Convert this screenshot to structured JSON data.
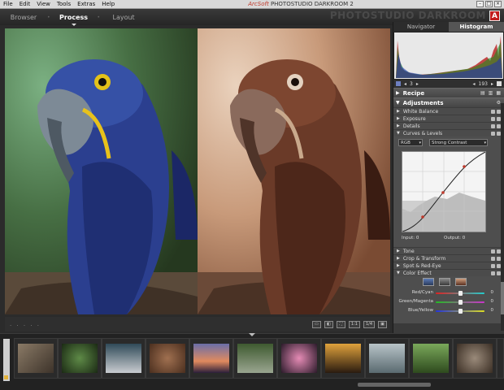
{
  "menubar": {
    "items": [
      "File",
      "Edit",
      "View",
      "Tools",
      "Extras",
      "Help"
    ],
    "brand_prefix": "ArcSoft",
    "app_title": "PHOTOSTUDIO DARKROOM 2"
  },
  "tabs": [
    {
      "label": "Browser"
    },
    {
      "label": "Process",
      "active": true
    },
    {
      "label": "Layout"
    }
  ],
  "watermark": "PHOTOSTUDIO DARKROOM",
  "panel": {
    "tabs": [
      {
        "label": "Navigator"
      },
      {
        "label": "Histogram",
        "active": true
      }
    ],
    "histogram_nav": {
      "left_value": "3",
      "right_value": "193"
    },
    "sections": {
      "recipe": "Recipe",
      "adjustments": "Adjustments"
    },
    "adjust_rows": [
      "White Balance",
      "Exposure",
      "Details",
      "Curves & Levels"
    ],
    "curves": {
      "channel": "RGB",
      "preset": "Strong Contrast",
      "input_label": "Input:",
      "input_value": "0",
      "output_label": "Output:",
      "output_value": "0"
    },
    "lower_rows": [
      "Tone",
      "Crop & Transform",
      "Spot & Red-Eye",
      "Color Effect"
    ],
    "color_effect": {
      "sliders": [
        {
          "label": "Red/Cyan",
          "value": "0",
          "position": 0.5
        },
        {
          "label": "Green/Magenta",
          "value": "0",
          "position": 0.5
        },
        {
          "label": "Blue/Yellow",
          "value": "0",
          "position": 0.5
        }
      ]
    }
  },
  "status": {
    "dots": ". . . . ."
  },
  "colors": {
    "accent_blue": "#6d7fc1",
    "curve_point": "#c0392b",
    "brand_red": "#c21d1d"
  }
}
